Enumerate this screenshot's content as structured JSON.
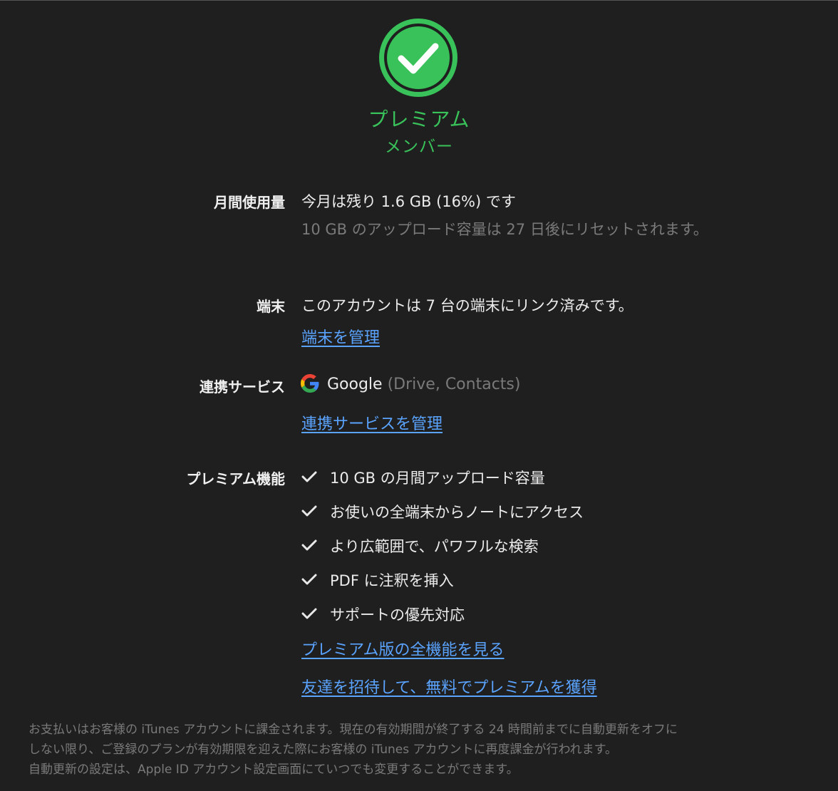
{
  "status": {
    "title_line1": "プレミアム",
    "title_line2": "メンバー",
    "color": "#39c25a"
  },
  "usage": {
    "label": "月間使用量",
    "remaining_text": "今月は残り 1.6 GB (16%) です",
    "reset_text": "10 GB のアップロード容量は 27 日後にリセットされます。"
  },
  "devices": {
    "label": "端末",
    "text": "このアカウントは 7 台の端末にリンク済みです。",
    "manage_link": "端末を管理"
  },
  "services": {
    "label": "連携サービス",
    "provider": "Google",
    "details": "(Drive, Contacts)",
    "manage_link": "連携サービスを管理"
  },
  "premium": {
    "label": "プレミアム機能",
    "features": [
      "10 GB の月間アップロード容量",
      "お使いの全端末からノートにアクセス",
      "より広範囲で、パワフルな検索",
      "PDF に注釈を挿入",
      "サポートの優先対応"
    ],
    "all_features_link": "プレミアム版の全機能を見る",
    "invite_link": "友達を招待して、無料でプレミアムを獲得"
  },
  "footer": {
    "line1": "お支払いはお客様の iTunes アカウントに課金されます。現在の有効期間が終了する 24 時間前までに自動更新をオフに",
    "line2": "しない限り、ご登録のプランが有効期限を迎えた際にお客様の iTunes アカウントに再度課金が行われます。",
    "line3": "自動更新の設定は、Apple ID アカウント設定画面にていつでも変更することができます。"
  },
  "colors": {
    "background": "#1f1f1f",
    "link": "#5aa3ff",
    "muted": "#7a7a7a",
    "accent": "#39c25a"
  }
}
